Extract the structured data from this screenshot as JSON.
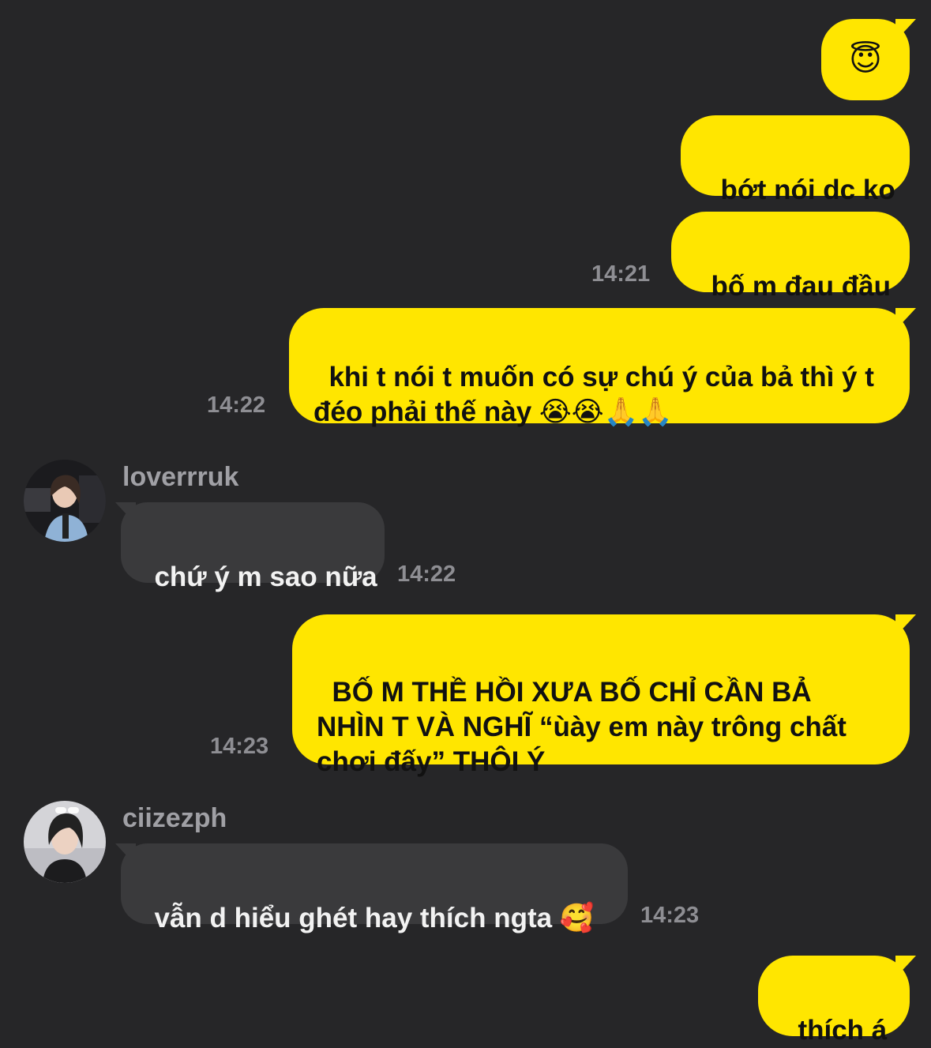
{
  "colors": {
    "background": "#262628",
    "outgoing_bubble": "#FFE600",
    "incoming_bubble": "#3A3A3C",
    "timestamp": "#8E8E93"
  },
  "messages": [
    {
      "side": "outgoing",
      "text": "😇",
      "time": ""
    },
    {
      "side": "outgoing",
      "text": "bớt nói dc ko",
      "time": ""
    },
    {
      "side": "outgoing",
      "text": "bố m đau đầu",
      "time": "14:21"
    },
    {
      "side": "outgoing",
      "text": "khi t nói t muốn có sự chú ý của bả thì ý t\nđéo phải thế này 😭😭🙏🙏",
      "time": "14:22"
    },
    {
      "side": "incoming",
      "sender": "loverrruk",
      "avatar": "profile-photo",
      "text": "chứ ý m sao nữa",
      "time": "14:22"
    },
    {
      "side": "outgoing",
      "text": "BỐ M THỀ HỒI XƯA BỐ CHỈ CẦN BẢ\nNHÌN T VÀ NGHĨ “ùày em này trông chất\nchơi đấy” THÔI Ý",
      "time": "14:23"
    },
    {
      "side": "incoming",
      "sender": "ciizezph",
      "avatar": "profile-photo",
      "text": "vẫn d hiểu ghét hay thích ngta 🥰",
      "time": "14:23"
    },
    {
      "side": "outgoing",
      "text": "thích á",
      "time": ""
    }
  ]
}
